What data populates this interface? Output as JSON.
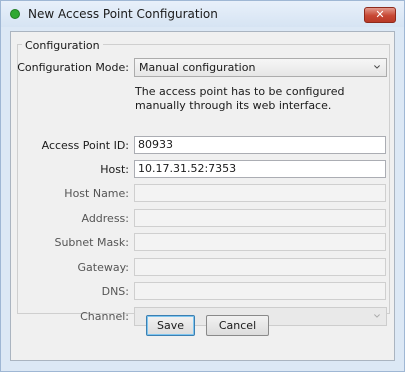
{
  "window": {
    "title": "New Access Point Configuration",
    "close_glyph": "✕",
    "status_color": "#2fa832"
  },
  "group": {
    "legend": "Configuration"
  },
  "config_mode": {
    "label": "Configuration Mode:",
    "selected": "Manual configuration",
    "note": "The access point has to be configured manually through its web interface."
  },
  "fields": {
    "access_point_id": {
      "label": "Access Point ID:",
      "value": "80933"
    },
    "host": {
      "label": "Host:",
      "value": "10.17.31.52:7353"
    },
    "host_name": {
      "label": "Host Name:",
      "value": ""
    },
    "address": {
      "label": "Address:",
      "value": ""
    },
    "subnet_mask": {
      "label": "Subnet Mask:",
      "value": ""
    },
    "gateway": {
      "label": "Gateway:",
      "value": ""
    },
    "dns": {
      "label": "DNS:",
      "value": ""
    },
    "channel": {
      "label": "Channel:",
      "value": ""
    }
  },
  "buttons": {
    "save": "Save",
    "cancel": "Cancel"
  },
  "icons": {
    "status": "status-dot-icon",
    "close": "close-icon",
    "dropdown": "chevron-down-icon"
  }
}
